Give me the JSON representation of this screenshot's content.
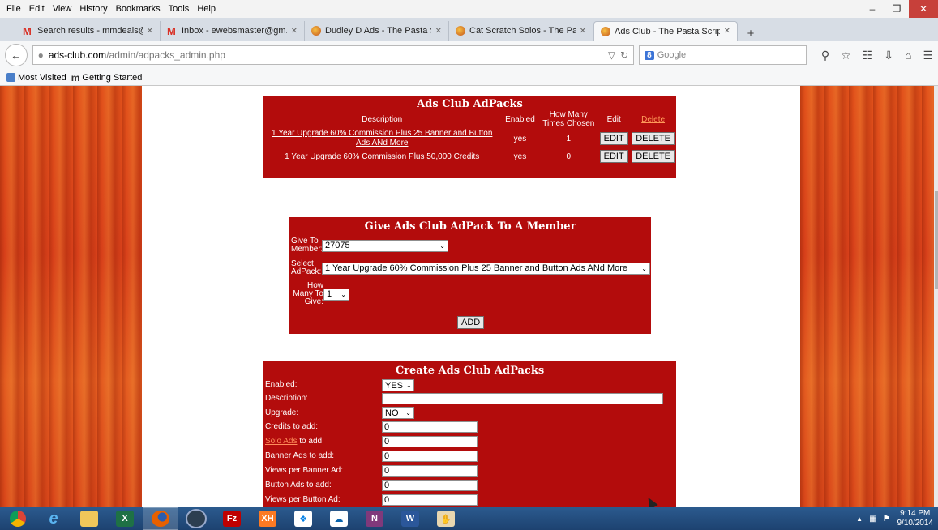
{
  "menu": [
    "File",
    "Edit",
    "View",
    "History",
    "Bookmarks",
    "Tools",
    "Help"
  ],
  "window_controls": {
    "minimize": "–",
    "restore": "❐",
    "close": "✕"
  },
  "tabs": [
    {
      "title": "Search results - mmdeals@...",
      "icon": "gmail-icon",
      "close": "✕"
    },
    {
      "title": "Inbox - ewebsmaster@gm...",
      "icon": "gmail-icon",
      "close": "✕"
    },
    {
      "title": "Dudley D Ads - The Pasta S...",
      "icon": "pasta-icon",
      "close": "✕"
    },
    {
      "title": "Cat Scratch Solos - The Pas...",
      "icon": "pasta-icon",
      "close": "✕"
    },
    {
      "title": "Ads Club - The Pasta Script...",
      "icon": "pasta-icon",
      "close": "✕",
      "active": true
    }
  ],
  "new_tab": "+",
  "url": {
    "host": "ads-club.com",
    "path": "/admin/adpacks_admin.php"
  },
  "search": {
    "engine_badge": "8",
    "placeholder": "Google"
  },
  "bookmarks": [
    "Most Visited",
    "Getting Started"
  ],
  "adpacks_table": {
    "title": "Ads Club AdPacks",
    "headers": [
      "Description",
      "Enabled",
      "How Many Times Chosen",
      "Edit",
      "Delete"
    ],
    "rows": [
      {
        "description": "1 Year Upgrade 60% Commission Plus 25 Banner and Button Ads ANd More",
        "enabled": "yes",
        "chosen": "1",
        "edit": "EDIT",
        "delete": "DELETE"
      },
      {
        "description": "1 Year Upgrade 60% Commission Plus 50,000 Credits",
        "enabled": "yes",
        "chosen": "0",
        "edit": "EDIT",
        "delete": "DELETE"
      }
    ]
  },
  "give_form": {
    "title": "Give Ads Club AdPack To A Member",
    "member_label": "Give To Member:",
    "member_value": "27075",
    "adpack_label": "Select AdPack:",
    "adpack_value": "1 Year Upgrade 60% Commission Plus 25 Banner and Button Ads ANd More",
    "count_label": "How Many To Give:",
    "count_value": "1",
    "add_button": "ADD"
  },
  "create_form": {
    "title": "Create Ads Club AdPacks",
    "enabled_label": "Enabled:",
    "enabled_value": "YES",
    "description_label": "Description:",
    "description_value": "",
    "upgrade_label": "Upgrade:",
    "upgrade_value": "NO",
    "credits_label": "Credits to add:",
    "credits_value": "0",
    "solo_link": "Solo Ads",
    "solo_label": " to add:",
    "solo_value": "0",
    "banner_label": "Banner Ads to add:",
    "banner_value": "0",
    "banner_views_label": "Views per Banner Ad:",
    "banner_views_value": "0",
    "button_label": "Button Ads to add:",
    "button_value": "0",
    "button_views_label": "Views per Button Ad:",
    "button_views_value": "0"
  },
  "taskbar": {
    "apps": [
      "chrome-icon",
      "ie-icon",
      "file-explorer-icon",
      "excel-icon",
      "firefox-icon",
      "media-icon",
      "filezilla-icon",
      "xampp-icon",
      "dropbox-icon",
      "onedrive-icon",
      "onenote-icon",
      "word-icon",
      "hand-icon"
    ],
    "excel_letter": "X",
    "filezilla_letter": "Fz",
    "xampp_letters": "XH",
    "onenote_letter": "N",
    "word_letter": "W",
    "tray_up": "▲",
    "time": "9:14 PM",
    "date": "9/10/2014"
  },
  "colors": {
    "panel_red": "#b30c0c",
    "link_orange": "#ff8c5a",
    "wood": "#e2521b",
    "taskbar": "#2b5a8e"
  }
}
